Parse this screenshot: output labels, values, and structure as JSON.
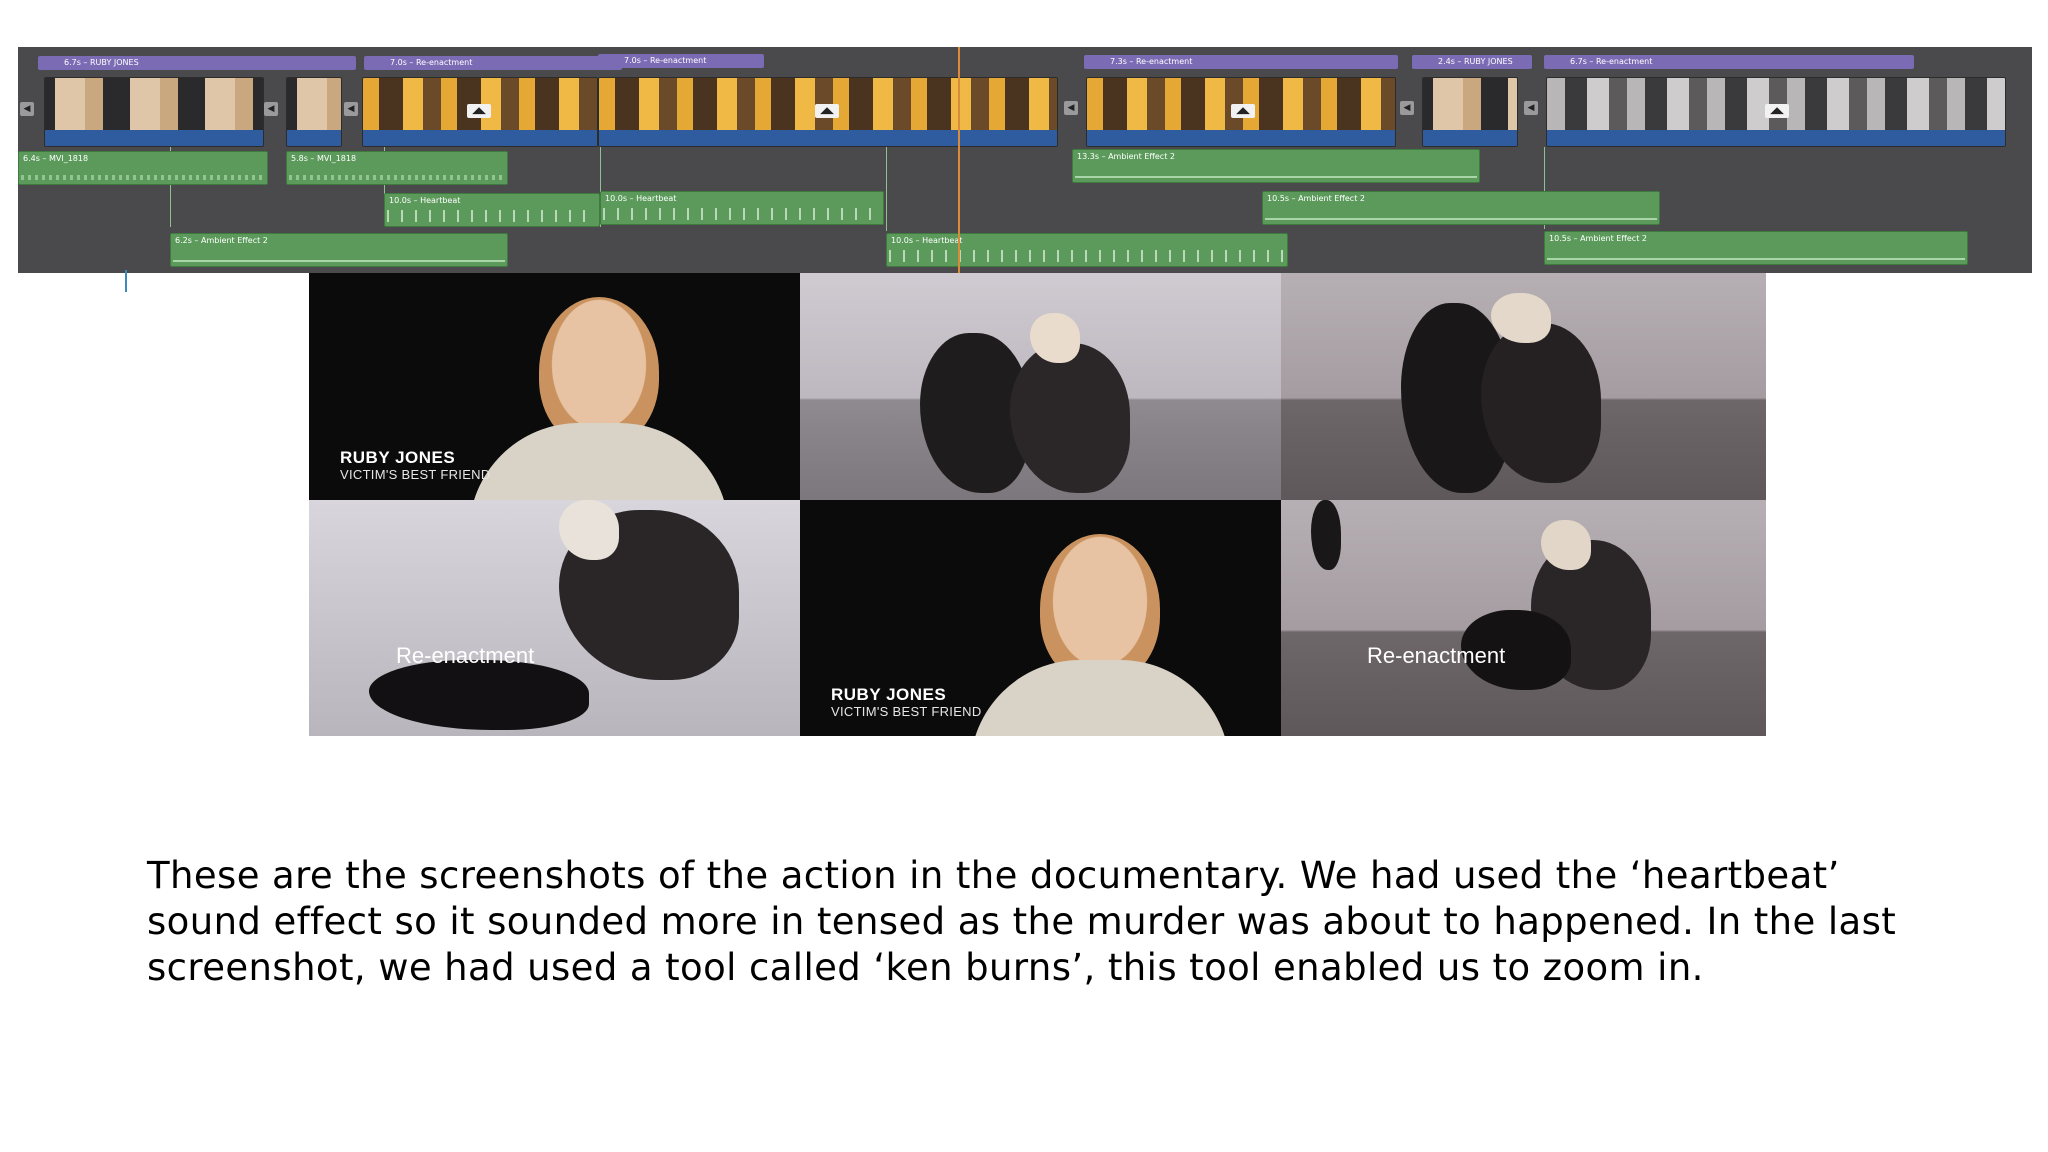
{
  "timeline": {
    "video_clips": [
      {
        "label": "6.7s – RUBY JONES",
        "kind": "interview"
      },
      {
        "label": "7.0s – Re-enactment",
        "kind": "reenact"
      },
      {
        "label": "7.0s – Re-enactment",
        "kind": "reenact"
      },
      {
        "label": "7.3s – Re-enactment",
        "kind": "reenact"
      },
      {
        "label": "2.4s – RUBY JONES",
        "kind": "interview"
      },
      {
        "label": "6.7s – Re-enactment",
        "kind": "reenact-bw"
      }
    ],
    "audio_clips": [
      {
        "label": "6.4s – MVI_1818"
      },
      {
        "label": "5.8s – MVI_1818"
      },
      {
        "label": "10.0s – Heartbeat"
      },
      {
        "label": "10.0s – Heartbeat"
      },
      {
        "label": "6.2s – Ambient Effect 2"
      },
      {
        "label": "10.0s – Heartbeat"
      },
      {
        "label": "13.3s – Ambient Effect 2"
      },
      {
        "label": "10.5s – Ambient Effect 2"
      },
      {
        "label": "10.5s – Ambient Effect 2"
      }
    ]
  },
  "stills": {
    "interview_1": {
      "name": "RUBY JONES",
      "role": "VICTIM'S BEST FRIEND"
    },
    "interview_2": {
      "name": "RUBY JONES",
      "role": "VICTIM'S BEST FRIEND"
    },
    "overlay_1": "Re-enactment",
    "overlay_2": "Re-enactment"
  },
  "description": "These are the screenshots of the action in the documentary. We had used the ‘heartbeat’ sound effect so it sounded more in tensed as the murder was about to happened. In the last screenshot, we had used a tool called ‘ken burns’, this tool enabled us to zoom in."
}
